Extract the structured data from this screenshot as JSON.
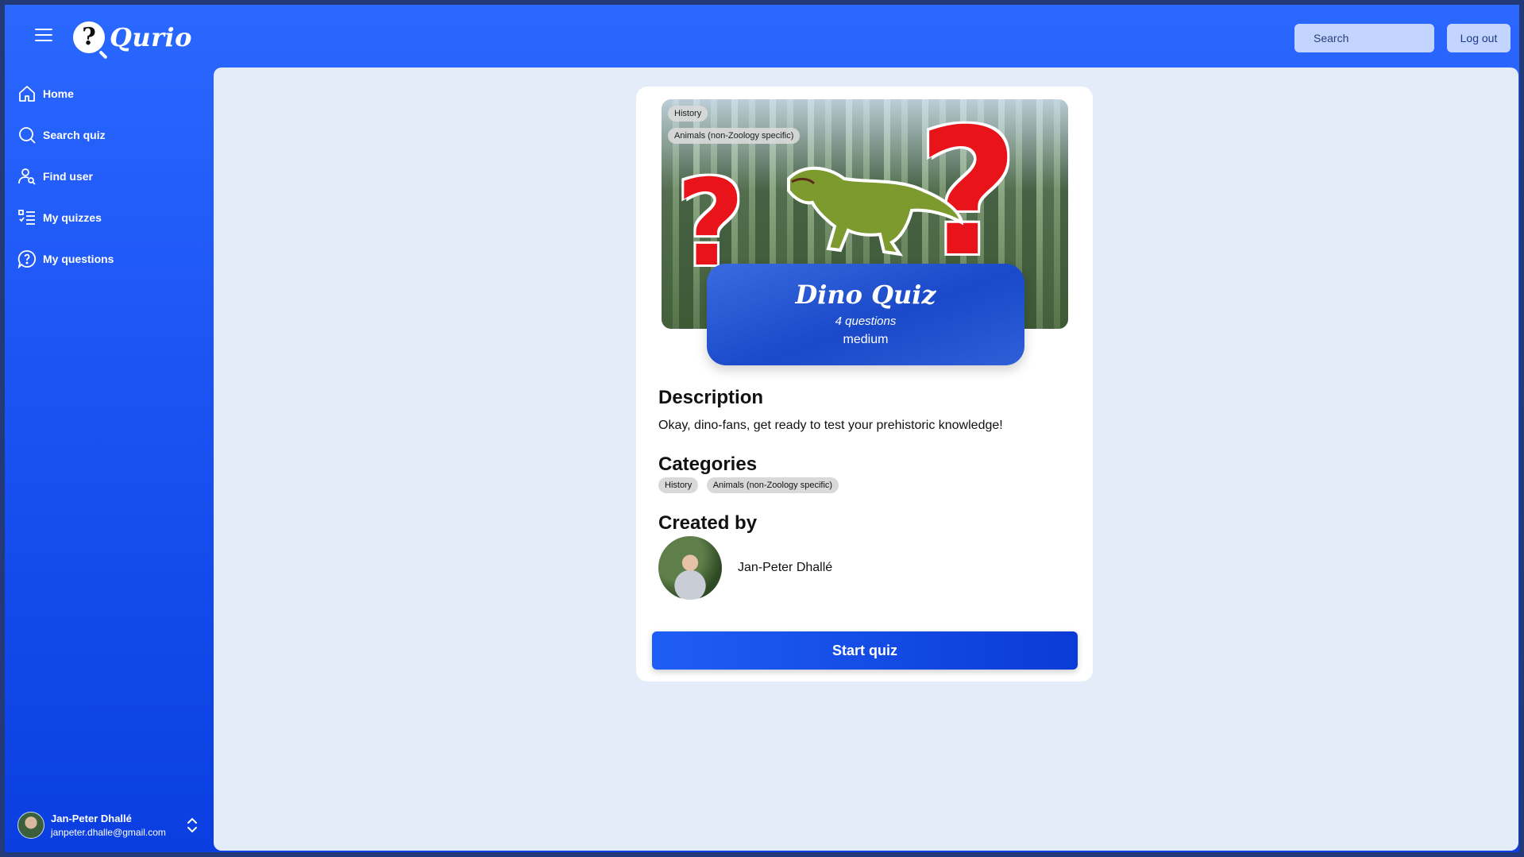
{
  "app": {
    "name": "Qurio",
    "logo_glyph": "?"
  },
  "header": {
    "search_placeholder": "Search",
    "logout_label": "Log out"
  },
  "sidebar": {
    "items": [
      {
        "label": "Home",
        "icon": "home-icon"
      },
      {
        "label": "Search quiz",
        "icon": "search-icon"
      },
      {
        "label": "Find user",
        "icon": "find-user-icon"
      },
      {
        "label": "My quizzes",
        "icon": "list-icon"
      },
      {
        "label": "My questions",
        "icon": "question-icon"
      }
    ],
    "user": {
      "name": "Jan-Peter Dhallé",
      "email": "janpeter.dhalle@gmail.com"
    }
  },
  "quiz": {
    "hero_tags": [
      "History",
      "Animals (non-Zoology specific)"
    ],
    "title": "Dino Quiz",
    "question_count": "4 questions",
    "difficulty": "medium",
    "description_heading": "Description",
    "description": "Okay, dino-fans, get ready to test your prehistoric knowledge!",
    "categories_heading": "Categories",
    "categories": [
      "History",
      "Animals (non-Zoology specific)"
    ],
    "created_by_heading": "Created by",
    "creator_name": "Jan-Peter Dhallé",
    "start_label": "Start quiz"
  },
  "colors": {
    "accent": "#1f5ef6",
    "sidebar_top": "#2a68ff",
    "sidebar_bottom": "#0a3ee0",
    "main_bg": "#e4ecfa",
    "chip_bg": "#d9d9d9"
  }
}
